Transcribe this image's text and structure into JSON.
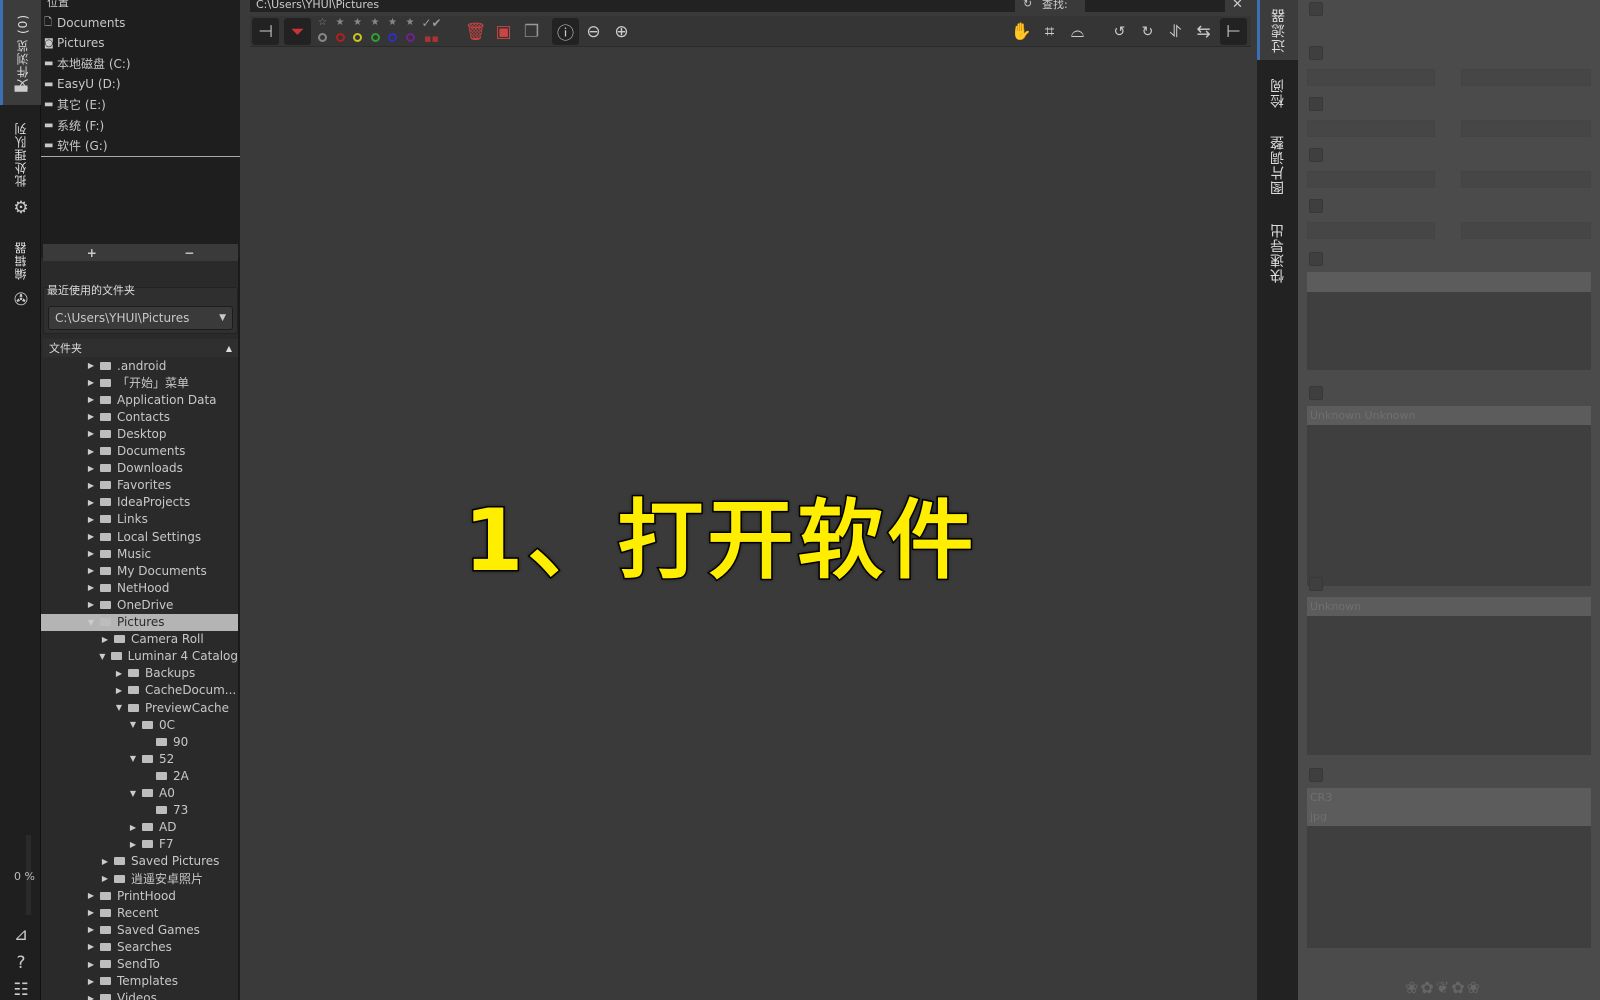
{
  "left_strip": {
    "tabs": [
      {
        "label": "文件浏览 (0)"
      },
      {
        "label": "批处理队列"
      },
      {
        "label": "编辑器"
      }
    ],
    "progress": "0 %"
  },
  "places": {
    "title": "位置",
    "items": [
      {
        "label": "Documents",
        "icon": "document-icon"
      },
      {
        "label": "Pictures",
        "icon": "camera-icon"
      },
      {
        "label": "本地磁盘 (C:)",
        "icon": "drive-icon"
      },
      {
        "label": "EasyU (D:)",
        "icon": "drive-icon"
      },
      {
        "label": "其它 (E:)",
        "icon": "drive-icon"
      },
      {
        "label": "系统 (F:)",
        "icon": "drive-icon"
      },
      {
        "label": "软件 (G:)",
        "icon": "drive-icon"
      }
    ],
    "add": "+",
    "remove": "−"
  },
  "recent": {
    "title": "最近使用的文件夹",
    "value": "C:\\Users\\YHUI\\Pictures"
  },
  "folders": {
    "title": "文件夹",
    "items": [
      {
        "label": ".android",
        "depth": 0,
        "state": "collapsed"
      },
      {
        "label": "「开始」菜单",
        "depth": 0,
        "state": "collapsed"
      },
      {
        "label": "Application Data",
        "depth": 0,
        "state": "collapsed"
      },
      {
        "label": "Contacts",
        "depth": 0,
        "state": "collapsed"
      },
      {
        "label": "Desktop",
        "depth": 0,
        "state": "collapsed"
      },
      {
        "label": "Documents",
        "depth": 0,
        "state": "collapsed"
      },
      {
        "label": "Downloads",
        "depth": 0,
        "state": "collapsed"
      },
      {
        "label": "Favorites",
        "depth": 0,
        "state": "collapsed"
      },
      {
        "label": "IdeaProjects",
        "depth": 0,
        "state": "collapsed"
      },
      {
        "label": "Links",
        "depth": 0,
        "state": "collapsed"
      },
      {
        "label": "Local Settings",
        "depth": 0,
        "state": "collapsed"
      },
      {
        "label": "Music",
        "depth": 0,
        "state": "collapsed"
      },
      {
        "label": "My Documents",
        "depth": 0,
        "state": "collapsed"
      },
      {
        "label": "NetHood",
        "depth": 0,
        "state": "collapsed"
      },
      {
        "label": "OneDrive",
        "depth": 0,
        "state": "collapsed"
      },
      {
        "label": "Pictures",
        "depth": 0,
        "state": "expanded",
        "selected": true
      },
      {
        "label": "Camera Roll",
        "depth": 1,
        "state": "collapsed"
      },
      {
        "label": "Luminar 4 Catalog",
        "depth": 1,
        "state": "expanded"
      },
      {
        "label": "Backups",
        "depth": 2,
        "state": "collapsed"
      },
      {
        "label": "CacheDocum...",
        "depth": 2,
        "state": "collapsed"
      },
      {
        "label": "PreviewCache",
        "depth": 2,
        "state": "expanded"
      },
      {
        "label": "0C",
        "depth": 3,
        "state": "expanded"
      },
      {
        "label": "90",
        "depth": 4,
        "state": "leaf"
      },
      {
        "label": "52",
        "depth": 3,
        "state": "expanded"
      },
      {
        "label": "2A",
        "depth": 4,
        "state": "leaf"
      },
      {
        "label": "A0",
        "depth": 3,
        "state": "expanded"
      },
      {
        "label": "73",
        "depth": 4,
        "state": "leaf"
      },
      {
        "label": "AD",
        "depth": 3,
        "state": "collapsed"
      },
      {
        "label": "F7",
        "depth": 3,
        "state": "collapsed"
      },
      {
        "label": "Saved Pictures",
        "depth": 1,
        "state": "collapsed"
      },
      {
        "label": "逍遥安卓照片",
        "depth": 1,
        "state": "collapsed"
      },
      {
        "label": "PrintHood",
        "depth": 0,
        "state": "collapsed"
      },
      {
        "label": "Recent",
        "depth": 0,
        "state": "collapsed"
      },
      {
        "label": "Saved Games",
        "depth": 0,
        "state": "collapsed"
      },
      {
        "label": "Searches",
        "depth": 0,
        "state": "collapsed"
      },
      {
        "label": "SendTo",
        "depth": 0,
        "state": "collapsed"
      },
      {
        "label": "Templates",
        "depth": 0,
        "state": "collapsed"
      },
      {
        "label": "Videos",
        "depth": 0,
        "state": "collapsed"
      }
    ]
  },
  "main": {
    "path": "C:\\Users\\YHUI\\Pictures",
    "find_label": "查找:",
    "close": "✕",
    "color_labels": [
      "#888888",
      "#b02020",
      "#c8c820",
      "#30a030",
      "#3030c0",
      "#702090"
    ],
    "caption": "1、打开软件",
    "caption_color": "#ffee00"
  },
  "right_strip": {
    "tabs": [
      {
        "label": "过滤器"
      },
      {
        "label": "检阅"
      },
      {
        "label": "图片调整"
      },
      {
        "label": "快速导出"
      }
    ]
  },
  "filter_panel": {
    "camera_list": [
      "Unknown Unknown"
    ],
    "lens_list": [
      "Unknown"
    ],
    "filetype_list": [
      "CR3",
      "jpg"
    ]
  }
}
